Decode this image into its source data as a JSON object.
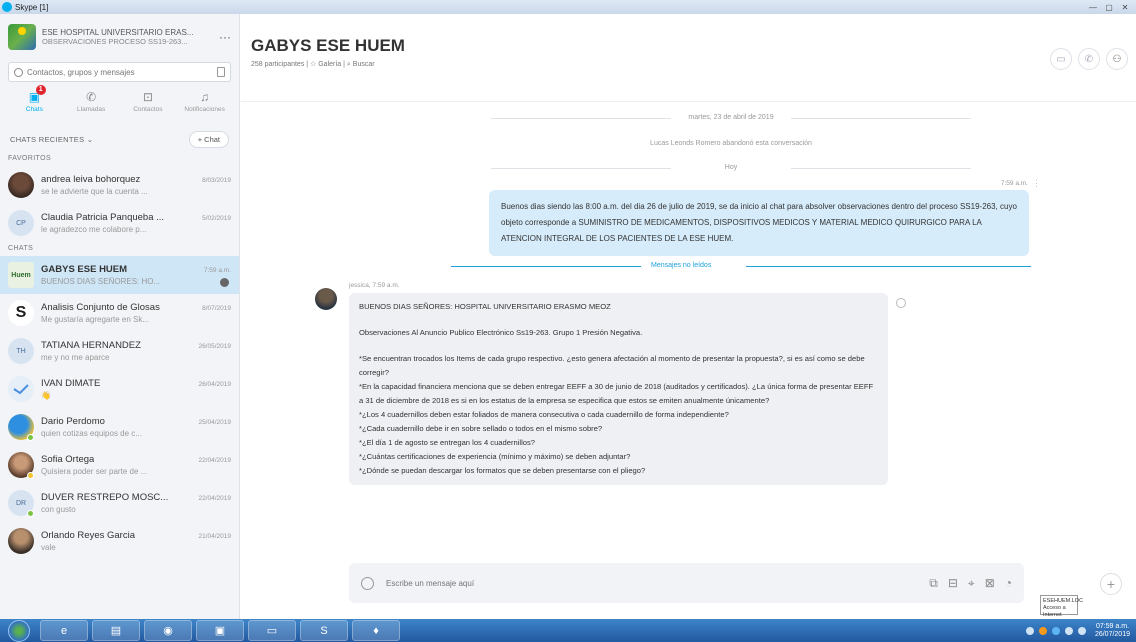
{
  "window": {
    "title": "Skype [1]",
    "controls": [
      "—",
      "▢",
      "✕"
    ]
  },
  "profile": {
    "name": "ESE HOSPITAL UNIVERSITARIO ERAS...",
    "status": "OBSERVACIONES PROCESO SS19-263...",
    "more": "···"
  },
  "search": {
    "placeholder": "Contactos, grupos y mensajes"
  },
  "nav": {
    "chats": "Chats",
    "chats_badge": "1",
    "calls": "Llamadas",
    "contacts": "Contactos",
    "notifications": "Notificaciones"
  },
  "sidebar": {
    "recent_label": "CHATS RECIENTES ⌄",
    "new_chat": "+ Chat",
    "favorites_label": "FAVORITOS",
    "chats_label": "CHATS",
    "favorites": [
      {
        "name": "andrea leiva bohorquez",
        "date": "8/03/2019",
        "preview": "se le advierte que la cuenta ..."
      },
      {
        "name": "Claudia Patricia Panqueba ...",
        "date": "5/02/2019",
        "preview": "le agradezco me colabore p...",
        "initials": "CP"
      }
    ],
    "chats": [
      {
        "name": "GABYS ESE HUEM",
        "date": "7:59 a.m.",
        "preview": "BUENOS DIAS SEÑORES: HO...",
        "initials": "Huem"
      },
      {
        "name": "Analisis Conjunto de Glosas",
        "date": "8/07/2019",
        "preview": "Me gustaría agregarte en Sk..."
      },
      {
        "name": "TATIANA HERNANDEZ",
        "date": "26/05/2019",
        "preview": "me y no me aparce",
        "initials": "TH"
      },
      {
        "name": "IVAN DIMATE",
        "date": "26/04/2019",
        "preview": "👋"
      },
      {
        "name": "Dario Perdomo",
        "date": "25/04/2019",
        "preview": "quien cotizas equipos de c..."
      },
      {
        "name": "Sofia Ortega",
        "date": "22/04/2019",
        "preview": "Quisiera poder ser parte de ..."
      },
      {
        "name": "DUVER RESTREPO MOSC...",
        "date": "22/04/2019",
        "preview": "con gusto",
        "initials": "DR"
      },
      {
        "name": "Orlando Reyes Garcia",
        "date": "21/04/2019",
        "preview": "vale"
      }
    ]
  },
  "chat": {
    "title": "GABYS ESE HUEM",
    "meta": "258 participantes | ☆ Galería | ⌕ Buscar",
    "date_divider": "martes, 23 de abril de 2019",
    "system_message": "Lucas Leonds Romero abandonó esta conversación",
    "today_divider": "Hoy",
    "outgoing": {
      "time": "7:59 a.m.",
      "more": "⋮",
      "text": "Buenos dias siendo las 8:00 a.m. del dia 26 de julio de 2019, se da inicio al chat para absolver observaciones dentro del proceso SS19-263, cuyo objeto corresponde a SUMINISTRO DE MEDICAMENTOS, DISPOSITIVOS MEDICOS Y MATERIAL MEDICO QUIRURGICO PARA LA ATENCION INTEGRAL DE LOS PACIENTES DE LA ESE HUEM."
    },
    "unread_label": "Mensajes no leídos",
    "incoming": {
      "author": "jessica, 7:59 a.m.",
      "lines": [
        "BUENOS DIAS SEÑORES: HOSPITAL UNIVERSITARIO ERASMO MEOZ",
        "",
        "Observaciones Al Anuncio Publico Electrónico Ss19-263.  Grupo 1 Presión Negativa.",
        "",
        "*Se encuentran trocados los Items de cada grupo respectivo. ¿esto genera afectación al momento de presentar la propuesta?, si es así como se debe corregir?",
        "*En la capacidad financiera menciona que se deben entregar EEFF a 30 de junio de 2018 (auditados y certificados). ¿La única forma de presentar EEFF a 31 de diciembre de 2018 es si en los estatus de la empresa se especifica que estos se emiten anualmente únicamente?",
        "*¿Los 4 cuadernillos deben estar foliados de manera consecutiva o cada cuadernillo de forma independiente?",
        "*¿Cada cuadernillo debe ir en sobre sellado o todos en el mismo sobre?",
        "*¿El día 1 de agosto se entregan los 4 cuadernillos?",
        "*¿Cuántas certificaciones de experiencia (mínimo y máximo) se deben adjuntar?",
        "*¿Dónde se puedan descargar los formatos que se deben presentarse con el pliego?"
      ]
    },
    "composer_placeholder": "Escribe un mensaje aquí"
  },
  "tooltip": {
    "line1": "ESEHUEM.LOC",
    "line2": "Acceso a Internet"
  },
  "taskbar": {
    "clock_time": "07:59 a.m.",
    "clock_date": "26/07/2019"
  }
}
